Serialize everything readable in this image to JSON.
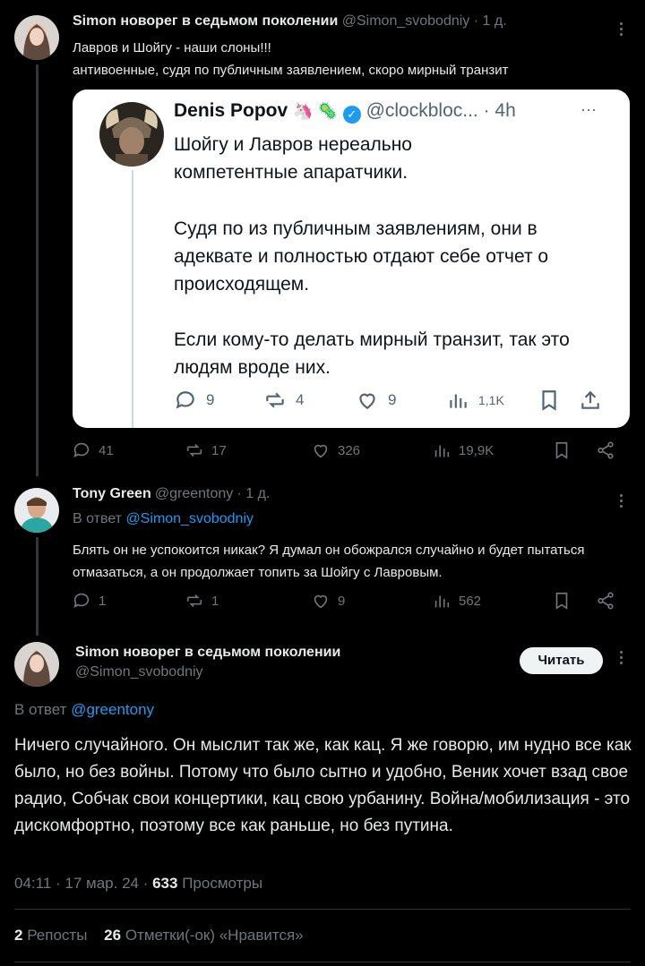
{
  "tweet1": {
    "name": "Simon новорег в седьмом поколении",
    "handle": "@Simon_svobodniy",
    "time": "· 1 д.",
    "line1": "Лавров и Шойгу - наши слоны!!!",
    "line2": "антивоенные, судя по публичным заявлением, скоро мирный транзит",
    "actions": {
      "reply": "41",
      "repost": "17",
      "like": "326",
      "views": "19,9K"
    }
  },
  "quote": {
    "name": "Denis Popov",
    "emoji": "🦄 🦠",
    "handle": "@clockbloc...",
    "time": "· 4h",
    "p1": "Шойгу и Лавров нереально компетентные апаратчики.",
    "p2": "Судя по из публичным заявлениям, они в адеквате и полностью отдают себе отчет о происходящем.",
    "p3": "Если кому-то делать мирный транзит, так это людям вроде них.",
    "actions": {
      "reply": "9",
      "repost": "4",
      "like": "9",
      "views": "1,1K"
    }
  },
  "tweet2": {
    "name": "Tony Green",
    "handle": "@greentony",
    "time": "· 1 д.",
    "reply_prefix": "В ответ",
    "reply_to": "@Simon_svobodniy",
    "text": "Блять он не успокоится никак? Я думал он обожрался случайно и будет пытаться отмазаться, а он продолжает топить за Шойгу с Лавровым.",
    "actions": {
      "reply": "1",
      "repost": "1",
      "like": "9",
      "views": "562"
    }
  },
  "main": {
    "name": "Simon новорег в седьмом поколении",
    "handle": "@Simon_svobodniy",
    "follow_label": "Читать",
    "reply_prefix": "В ответ",
    "reply_to": "@greentony",
    "text": "Ничего случайного.  Он мыслит так же, как кац. Я же говорю, им нудно все как было, но без войны. Потому что было сытно и удобно, Веник хочет взад свое радио,  Собчак свои концертики, кац свою урбанину. Война/мобилизация - это дискомфортно, поэтому все как раньше, но без путина.",
    "time": "04:11 · 17 мар. 24 ·",
    "views_count": "633",
    "views_label": "Просмотры",
    "reposts_count": "2",
    "reposts_label": "Репосты",
    "likes_count": "26",
    "likes_label": "Отметки(-ок) «Нравится»"
  },
  "colors": {
    "accent": "#1d9bf0",
    "verified": "#1d9bf0",
    "background": "#000000"
  }
}
